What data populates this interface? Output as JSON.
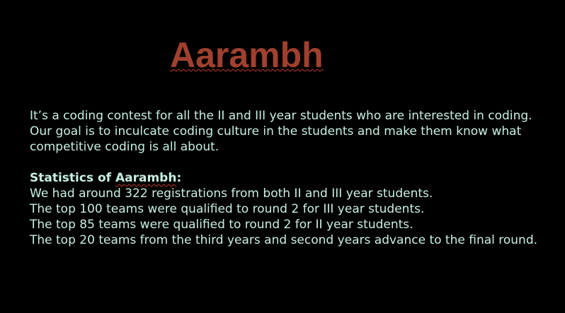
{
  "colors": {
    "background": "#000000",
    "title": "#a0402e",
    "body_text": "#c8f0e0",
    "spellcheck_underline": "#c0392b"
  },
  "title": "Aarambh",
  "intro": "It’s a coding contest for all the II and III year students who are interested in coding. Our goal is to inculcate coding culture in the students and make them know what competitive coding is all about.",
  "statistics": {
    "heading_prefix": "Statistics of ",
    "heading_name": "Aarambh",
    "heading_suffix": ":",
    "lines": [
      "We had around 322 registrations from both II and III year students.",
      "The top 100 teams were qualified to round 2 for  III year students.",
      "The top 85 teams were qualified to round 2 for II year students.",
      "The top 20 teams from the third years and second years advance to the final round."
    ]
  }
}
